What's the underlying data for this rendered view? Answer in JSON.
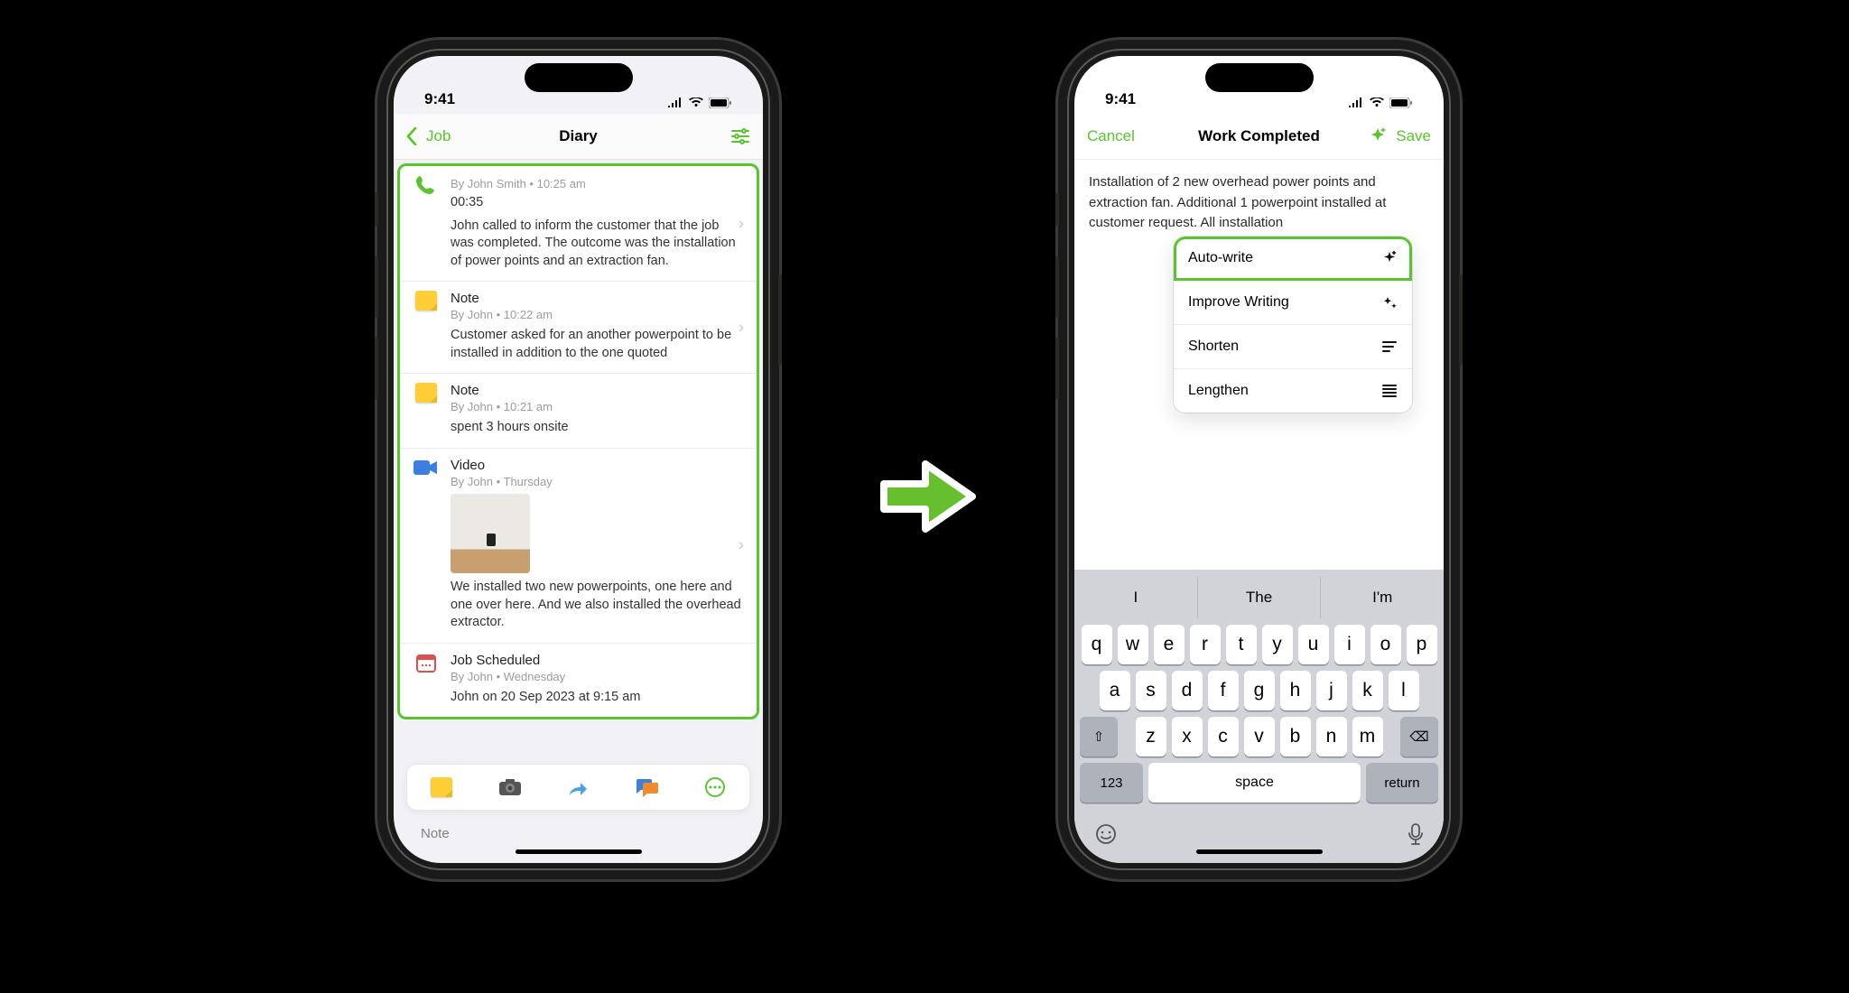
{
  "status": {
    "time": "9:41"
  },
  "accent": "#59c42d",
  "phone1": {
    "nav": {
      "back": "Job",
      "title": "Diary"
    },
    "entries": [
      {
        "kind": "call",
        "meta": "By John Smith • 10:25 am",
        "duration": "00:35",
        "body": "John called to inform the customer that the job was completed. The outcome was the installation of power points and an extraction fan."
      },
      {
        "kind": "note",
        "title": "Note",
        "meta": "By John • 10:22 am",
        "body": "Customer asked for an another powerpoint to be installed in addition to the one quoted"
      },
      {
        "kind": "note",
        "title": "Note",
        "meta": "By John • 10:21 am",
        "body": "spent 3 hours onsite"
      },
      {
        "kind": "video",
        "title": "Video",
        "meta": "By John • Thursday",
        "body": "We installed two new powerpoints, one here and one over here. And we also installed the overhead extractor."
      },
      {
        "kind": "scheduled",
        "title": "Job Scheduled",
        "meta": "By John • Wednesday",
        "body": "John on 20 Sep 2023 at 9:15 am"
      }
    ],
    "toolbar": [
      "note",
      "camera",
      "share",
      "chat",
      "more"
    ],
    "peek": "Note"
  },
  "phone2": {
    "nav": {
      "cancel": "Cancel",
      "title": "Work Completed",
      "save": "Save"
    },
    "editor_text": "Installation of 2 new overhead power points and extraction fan. Additional 1 powerpoint installed at customer request. All installation",
    "menu": [
      {
        "label": "Auto-write",
        "icon": "sparkle-plus",
        "selected": true
      },
      {
        "label": "Improve Writing",
        "icon": "sparkle-stars"
      },
      {
        "label": "Shorten",
        "icon": "lines-short"
      },
      {
        "label": "Lengthen",
        "icon": "lines-long"
      }
    ],
    "keyboard": {
      "predictions": [
        "I",
        "The",
        "I'm"
      ],
      "rows": [
        [
          "q",
          "w",
          "e",
          "r",
          "t",
          "y",
          "u",
          "i",
          "o",
          "p"
        ],
        [
          "a",
          "s",
          "d",
          "f",
          "g",
          "h",
          "j",
          "k",
          "l"
        ],
        [
          "z",
          "x",
          "c",
          "v",
          "b",
          "n",
          "m"
        ]
      ],
      "fn": {
        "shift": "⇧",
        "num": "123",
        "space": "space",
        "return": "return",
        "del": "⌫"
      }
    }
  }
}
